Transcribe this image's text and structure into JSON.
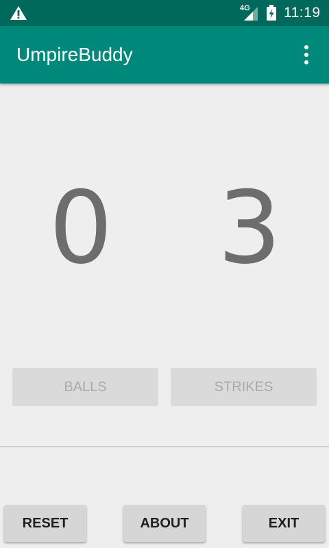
{
  "status_bar": {
    "network": "4G",
    "time": "11:19",
    "icons": [
      "warning-icon",
      "signal-icon",
      "battery-charging-icon"
    ]
  },
  "app_bar": {
    "title": "UmpireBuddy",
    "menu_icon": "more-vert-icon"
  },
  "counts": {
    "balls": "0",
    "strikes": "3"
  },
  "buttons": {
    "balls": "BALLS",
    "strikes": "STRIKES",
    "reset": "RESET",
    "about": "ABOUT",
    "exit": "EXIT"
  },
  "colors": {
    "status_bar": "#00695c",
    "app_bar": "#00897b",
    "background": "#eeeeee",
    "count_text": "#6d6d6d"
  }
}
